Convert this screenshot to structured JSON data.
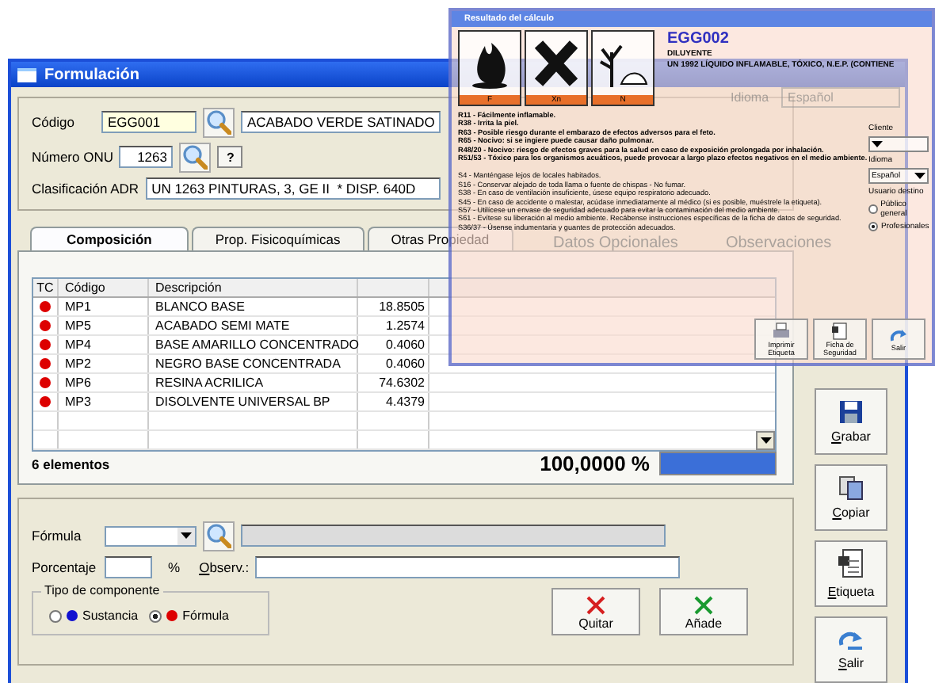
{
  "window": {
    "title": "Formulación"
  },
  "form": {
    "code_label": "Código",
    "code_value": "EGG001",
    "description_value": "ACABADO VERDE SATINADO",
    "onu_label": "Número ONU",
    "onu_value": "1263",
    "help_button": "?",
    "adr_label": "Clasificación ADR",
    "adr_value": "UN 1263 PINTURAS, 3, GE II  * DISP. 640D"
  },
  "tabs": [
    {
      "label": "Composición",
      "selected": true
    },
    {
      "label": "Prop. Fisicoquímicas",
      "selected": false
    },
    {
      "label": "Otras Propiedad",
      "selected": false
    }
  ],
  "table": {
    "columns": [
      "TC",
      "Código",
      "Descripción"
    ],
    "rows": [
      {
        "color": "#dd0000",
        "code": "MP1",
        "description": "BLANCO BASE",
        "column_4": "18.8505"
      },
      {
        "color": "#dd0000",
        "code": "MP5",
        "description": "ACABADO SEMI MATE",
        "column_4": "1.2574"
      },
      {
        "color": "#dd0000",
        "code": "MP4",
        "description": "BASE AMARILLO CONCENTRADO",
        "column_4": "0.4060"
      },
      {
        "color": "#dd0000",
        "code": "MP2",
        "description": "NEGRO BASE CONCENTRADA",
        "column_4": "0.4060"
      },
      {
        "color": "#dd0000",
        "code": "MP6",
        "description": "RESINA ACRILICA",
        "column_4": "74.6302"
      },
      {
        "color": "#dd0000",
        "code": "MP3",
        "description": "DISOLVENTE UNIVERSAL BP",
        "column_4": "4.4379"
      }
    ]
  },
  "summary": {
    "count": "6 elementos",
    "total": "100,0000 %",
    "level": 1
  },
  "entry": {
    "formula_label": "Fórmula",
    "percent_label": "Porcentaje",
    "percent_sign": "%",
    "observ_label": "Observ.:",
    "component_type": {
      "title": "Tipo de componente",
      "options": [
        {
          "label": "Sustancia",
          "color": "#1010d0",
          "selected": false
        },
        {
          "label": "Fórmula",
          "color": "#dd0000",
          "selected": true
        }
      ]
    },
    "buttons": [
      {
        "label": "Quitar",
        "kind": "remove"
      },
      {
        "label": "Añade",
        "kind": "add"
      }
    ]
  },
  "side_buttons": [
    {
      "label": "Grabar",
      "kind": "save"
    },
    {
      "label": "Copiar",
      "kind": "copy"
    },
    {
      "label": "Etiqueta",
      "kind": "label"
    },
    {
      "label": "Salir",
      "kind": "exit"
    }
  ],
  "overlay": {
    "title": "Resultado del cálculo",
    "pictograms": [
      {
        "kind": "flame",
        "code": "F"
      },
      {
        "kind": "cross",
        "code": "Xn"
      },
      {
        "kind": "tree",
        "code": "N"
      }
    ],
    "code": "EGG002",
    "name": "DILUYENTE",
    "un_text": "UN 1992 LÍQUIDO INFLAMABLE, TÓXICO, N.E.P. (CONTIENE",
    "idioma_label": "Idioma",
    "idioma_value": "Español",
    "r_phrases": [
      "R11 - Fácilmente inflamable.",
      "R38 - Irrita la piel.",
      "R63 - Posible riesgo durante el embarazo de efectos adversos para el feto.",
      "R65 - Nocivo: si se ingiere puede causar daño pulmonar.",
      "R48/20 - Nocivo: riesgo de efectos graves para la salud en caso de exposición prolongada por inhalación.",
      "R51/53 - Tóxico para los organismos acuáticos, puede provocar a largo plazo efectos negativos en el medio ambiente."
    ],
    "s_phrases": [
      "S4 - Manténgase lejos de locales habitados.",
      "S16 - Conservar alejado de toda llama o fuente de chispas - No fumar.",
      "S38 - En caso de ventilación insuficiente, úsese equipo respiratorio adecuado.",
      "S45 - En caso de accidente o malestar, acúdase inmediatamente al médico (si es posible, muéstrele la etiqueta).",
      "S57 - Utilícese un envase de seguridad adecuado para evitar la contaminación del medio ambiente.",
      "S61 - Evítese su liberación al medio ambiente. Recábense instrucciones específicas de la ficha de datos de seguridad.",
      "S36/37 - Úsense indumentaria y guantes de protección adecuados."
    ],
    "client_label": "Cliente",
    "language_label": "Idioma",
    "language_value": "Español",
    "audience": {
      "title": "Usuario destino",
      "options": [
        {
          "label": "Público general",
          "selected": false
        },
        {
          "label": "Profesionales",
          "selected": true
        }
      ]
    },
    "ghost_tab": "Datos Opcionales",
    "ghost_header": "Observaciones",
    "buttons": [
      {
        "label": "Imprimir Etiqueta",
        "kind": "print"
      },
      {
        "label": "Ficha de Seguridad",
        "kind": "sheet"
      },
      {
        "label": "Salir",
        "kind": "exit"
      }
    ]
  }
}
